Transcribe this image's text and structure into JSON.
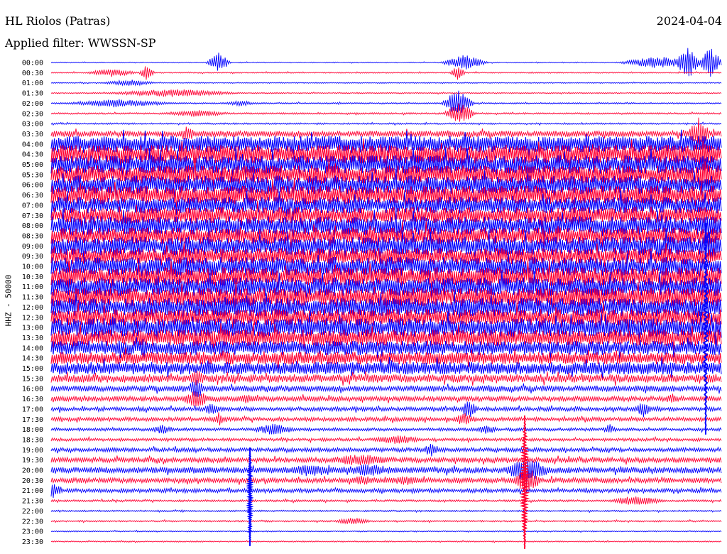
{
  "header": {
    "station": "HL Riolos (Patras)",
    "filter": "Applied filter: WWSSN-SP",
    "date": "2024-04-04"
  },
  "colors": {
    "odd": "#0000ff",
    "even": "#ff0033",
    "background": "#ffffff"
  },
  "chart_data": {
    "type": "line",
    "ylabel": "HHZ - 50000",
    "row_labels": [
      "00:00",
      "00:30",
      "01:00",
      "01:30",
      "02:00",
      "02:30",
      "03:00",
      "03:30",
      "04:00",
      "04:30",
      "05:00",
      "05:30",
      "06:00",
      "06:30",
      "07:00",
      "07:30",
      "08:00",
      "08:30",
      "09:00",
      "09:30",
      "10:00",
      "10:30",
      "11:00",
      "11:30",
      "12:00",
      "12:30",
      "13:00",
      "13:30",
      "14:00",
      "14:30",
      "15:00",
      "15:30",
      "16:00",
      "16:30",
      "17:00",
      "17:30",
      "18:00",
      "18:30",
      "19:00",
      "19:30",
      "20:00",
      "20:30",
      "21:00",
      "21:30",
      "22:00",
      "22:30",
      "23:00",
      "23:30"
    ],
    "noise_level": [
      0.5,
      0.6,
      0.5,
      0.6,
      0.7,
      0.8,
      0.8,
      3,
      8,
      9,
      9,
      9,
      9,
      9,
      8,
      8,
      9,
      8,
      9,
      8,
      9,
      9,
      9,
      9,
      9,
      8,
      9,
      8,
      7,
      6,
      6,
      4,
      3,
      2.5,
      2,
      2,
      1.5,
      1.5,
      2,
      2.5,
      3,
      2.5,
      2,
      1,
      0.8,
      0.8,
      0.6,
      0.6
    ],
    "bursts": [
      {
        "row": 0,
        "minute": 7.5,
        "duration": 0.6,
        "amp": 14
      },
      {
        "row": 0,
        "minute": 18.5,
        "duration": 1.2,
        "amp": 11
      },
      {
        "row": 0,
        "minute": 27.2,
        "duration": 2.0,
        "amp": 9
      },
      {
        "row": 0,
        "minute": 28.5,
        "duration": 0.6,
        "amp": 25
      },
      {
        "row": 0,
        "minute": 29.5,
        "duration": 0.6,
        "amp": 22
      },
      {
        "row": 1,
        "minute": 2.7,
        "duration": 1.4,
        "amp": 6
      },
      {
        "row": 1,
        "minute": 4.3,
        "duration": 0.4,
        "amp": 12
      },
      {
        "row": 1,
        "minute": 18.2,
        "duration": 0.4,
        "amp": 10
      },
      {
        "row": 2,
        "minute": 3.5,
        "duration": 1.4,
        "amp": 5
      },
      {
        "row": 3,
        "minute": 5.5,
        "duration": 3.5,
        "amp": 6
      },
      {
        "row": 4,
        "minute": 3.0,
        "duration": 3.0,
        "amp": 6
      },
      {
        "row": 4,
        "minute": 8.5,
        "duration": 1.0,
        "amp": 4
      },
      {
        "row": 4,
        "minute": 18.2,
        "duration": 0.8,
        "amp": 20
      },
      {
        "row": 5,
        "minute": 6.5,
        "duration": 2.0,
        "amp": 5
      },
      {
        "row": 5,
        "minute": 18.3,
        "duration": 0.8,
        "amp": 16
      },
      {
        "row": 7,
        "minute": 6.1,
        "duration": 0.5,
        "amp": 12
      },
      {
        "row": 7,
        "minute": 29.0,
        "duration": 0.6,
        "amp": 24
      },
      {
        "row": 9,
        "minute": 29.2,
        "duration": 0.8,
        "amp": 24
      },
      {
        "row": 11,
        "minute": 29.2,
        "duration": 0.8,
        "amp": 24
      },
      {
        "row": 16,
        "minute": 29.4,
        "duration": 0.8,
        "amp": 20
      },
      {
        "row": 18,
        "minute": 29.5,
        "duration": 0.9,
        "amp": 22
      },
      {
        "row": 23,
        "minute": 16.5,
        "duration": 2.0,
        "amp": 14
      },
      {
        "row": 31,
        "minute": 6.5,
        "duration": 0.5,
        "amp": 14
      },
      {
        "row": 32,
        "minute": 6.5,
        "duration": 0.5,
        "amp": 16
      },
      {
        "row": 33,
        "minute": 6.5,
        "duration": 0.8,
        "amp": 14
      },
      {
        "row": 33,
        "minute": 8.8,
        "duration": 1.0,
        "amp": 7
      },
      {
        "row": 33,
        "minute": 27.8,
        "duration": 0.5,
        "amp": 8
      },
      {
        "row": 34,
        "minute": 7.2,
        "duration": 0.5,
        "amp": 10
      },
      {
        "row": 34,
        "minute": 18.7,
        "duration": 0.5,
        "amp": 14
      },
      {
        "row": 34,
        "minute": 26.5,
        "duration": 0.5,
        "amp": 12
      },
      {
        "row": 35,
        "minute": 7.5,
        "duration": 0.4,
        "amp": 10
      },
      {
        "row": 35,
        "minute": 18.5,
        "duration": 0.7,
        "amp": 10
      },
      {
        "row": 36,
        "minute": 5.0,
        "duration": 0.7,
        "amp": 7
      },
      {
        "row": 36,
        "minute": 10.0,
        "duration": 1.2,
        "amp": 9
      },
      {
        "row": 36,
        "minute": 19.5,
        "duration": 0.7,
        "amp": 7
      },
      {
        "row": 36,
        "minute": 25.0,
        "duration": 0.4,
        "amp": 8
      },
      {
        "row": 37,
        "minute": 15.5,
        "duration": 1.5,
        "amp": 7
      },
      {
        "row": 38,
        "minute": 17.0,
        "duration": 0.5,
        "amp": 10
      },
      {
        "row": 39,
        "minute": 13.8,
        "duration": 2.0,
        "amp": 9
      },
      {
        "row": 40,
        "minute": 11.6,
        "duration": 2.2,
        "amp": 9
      },
      {
        "row": 40,
        "minute": 14.2,
        "duration": 2.2,
        "amp": 9
      },
      {
        "row": 40,
        "minute": 21.3,
        "duration": 1.2,
        "amp": 20
      },
      {
        "row": 41,
        "minute": 14.0,
        "duration": 1.4,
        "amp": 7
      },
      {
        "row": 41,
        "minute": 15.9,
        "duration": 1.4,
        "amp": 7
      },
      {
        "row": 41,
        "minute": 21.3,
        "duration": 0.8,
        "amp": 20
      },
      {
        "row": 42,
        "minute": 0.1,
        "duration": 0.6,
        "amp": 12
      },
      {
        "row": 43,
        "minute": 26.2,
        "duration": 1.5,
        "amp": 8
      },
      {
        "row": 45,
        "minute": 13.5,
        "duration": 1.0,
        "amp": 6
      }
    ],
    "vertical_spikes": [
      {
        "minute": 8.9,
        "from_row": 38,
        "to_row": 47,
        "amp": 16,
        "color_key": "odd"
      },
      {
        "minute": 21.2,
        "from_row": 35,
        "to_row": 47,
        "amp": 26,
        "color_key": "even"
      },
      {
        "minute": 29.3,
        "from_row": 16,
        "to_row": 36,
        "amp": 18,
        "color_key": "odd"
      }
    ]
  }
}
